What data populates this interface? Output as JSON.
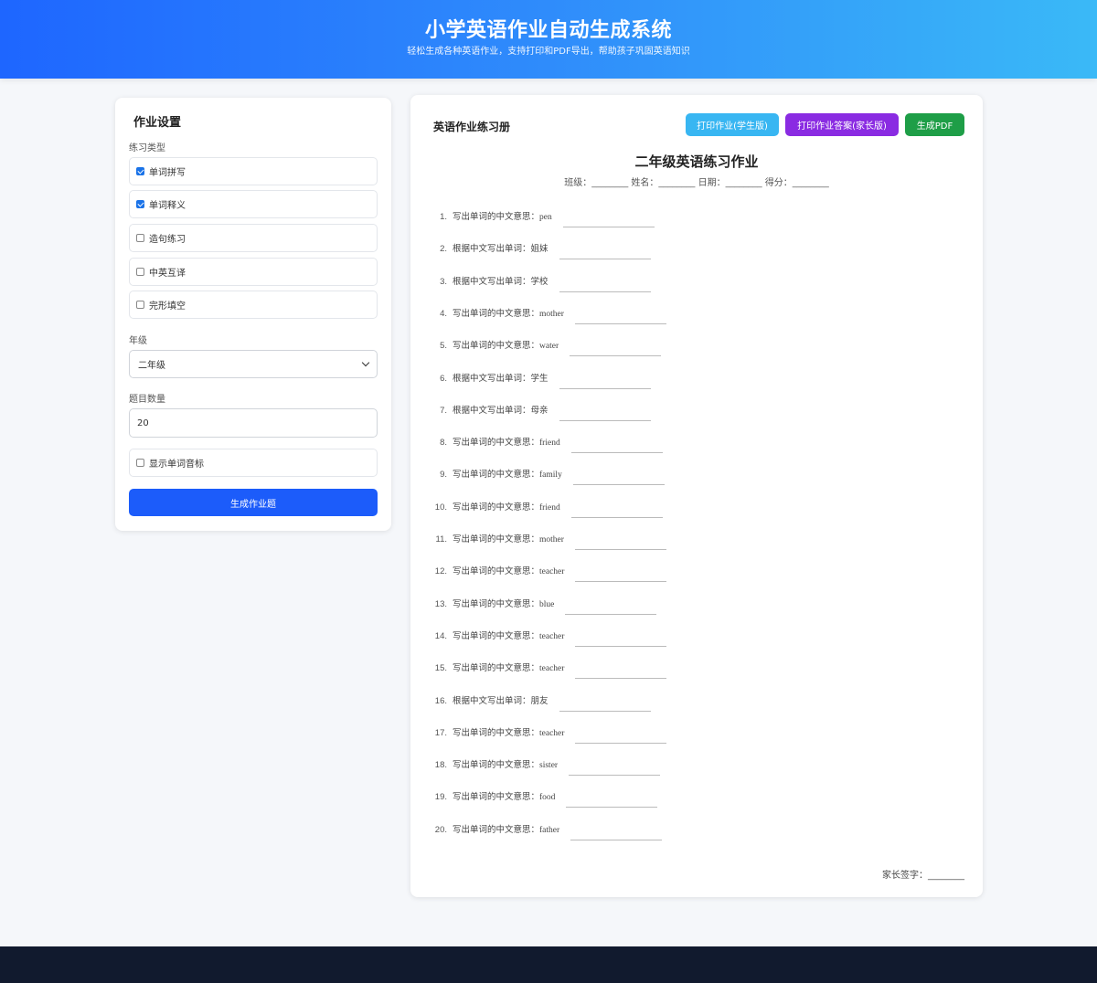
{
  "header": {
    "title": "小学英语作业自动生成系统",
    "subtitle": "轻松生成各种英语作业，支持打印和PDF导出，帮助孩子巩固英语知识"
  },
  "settings": {
    "title": "作业设置",
    "practice_type_label": "练习类型",
    "types": [
      {
        "label": "单词拼写",
        "checked": true
      },
      {
        "label": "单词释义",
        "checked": true
      },
      {
        "label": "造句练习",
        "checked": false
      },
      {
        "label": "中英互译",
        "checked": false
      },
      {
        "label": "完形填空",
        "checked": false
      }
    ],
    "grade_label": "年级",
    "grade_value": "二年级",
    "count_label": "题目数量",
    "count_value": "20",
    "phonetic_label": "显示单词音标",
    "phonetic_checked": false,
    "generate_label": "生成作业题"
  },
  "workbook": {
    "title": "英语作业练习册",
    "print_student_label": "打印作业(学生版)",
    "print_parent_label": "打印作业答案(家长版)",
    "pdf_label": "生成PDF",
    "sheet_title": "二年级英语练习作业",
    "sheet_info": "班级：________ 姓名：________ 日期：________ 得分：________",
    "questions": [
      {
        "num": "1.",
        "prompt": "写出单词的中文意思：",
        "word": "pen"
      },
      {
        "num": "2.",
        "prompt": "根据中文写出单词：",
        "word": "姐妹"
      },
      {
        "num": "3.",
        "prompt": "根据中文写出单词：",
        "word": "学校"
      },
      {
        "num": "4.",
        "prompt": "写出单词的中文意思：",
        "word": "mother"
      },
      {
        "num": "5.",
        "prompt": "写出单词的中文意思：",
        "word": "water"
      },
      {
        "num": "6.",
        "prompt": "根据中文写出单词：",
        "word": "学生"
      },
      {
        "num": "7.",
        "prompt": "根据中文写出单词：",
        "word": "母亲"
      },
      {
        "num": "8.",
        "prompt": "写出单词的中文意思：",
        "word": "friend"
      },
      {
        "num": "9.",
        "prompt": "写出单词的中文意思：",
        "word": "family"
      },
      {
        "num": "10.",
        "prompt": "写出单词的中文意思：",
        "word": "friend"
      },
      {
        "num": "11.",
        "prompt": "写出单词的中文意思：",
        "word": "mother"
      },
      {
        "num": "12.",
        "prompt": "写出单词的中文意思：",
        "word": "teacher"
      },
      {
        "num": "13.",
        "prompt": "写出单词的中文意思：",
        "word": "blue"
      },
      {
        "num": "14.",
        "prompt": "写出单词的中文意思：",
        "word": "teacher"
      },
      {
        "num": "15.",
        "prompt": "写出单词的中文意思：",
        "word": "teacher"
      },
      {
        "num": "16.",
        "prompt": "根据中文写出单词：",
        "word": "朋友"
      },
      {
        "num": "17.",
        "prompt": "写出单词的中文意思：",
        "word": "teacher"
      },
      {
        "num": "18.",
        "prompt": "写出单词的中文意思：",
        "word": "sister"
      },
      {
        "num": "19.",
        "prompt": "写出单词的中文意思：",
        "word": "food"
      },
      {
        "num": "20.",
        "prompt": "写出单词的中文意思：",
        "word": "father"
      }
    ],
    "signature": "家长签字：________"
  }
}
